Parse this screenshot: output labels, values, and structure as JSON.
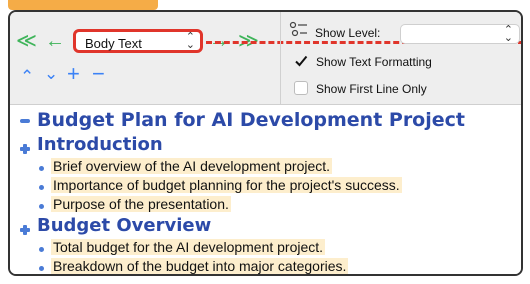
{
  "toolbar": {
    "style_select_value": "Body Text",
    "show_level_label": "Show Level:",
    "show_text_formatting_label": "Show Text Formatting",
    "show_first_line_only_label": "Show First Line Only",
    "show_text_formatting_checked": true,
    "show_first_line_only_checked": false
  },
  "document": {
    "title": "Budget Plan for AI Development Project",
    "sections": [
      {
        "heading": "Introduction",
        "items": [
          "Brief overview of the AI development project.",
          "Importance of budget planning for the project's success.",
          "Purpose of the presentation."
        ]
      },
      {
        "heading": "Budget Overview",
        "items": [
          "Total budget for the AI development project.",
          "Breakdown of the budget into major categories."
        ]
      }
    ]
  },
  "colors": {
    "accent_red": "#e0352b",
    "nav_green": "#3fb45a",
    "control_blue": "#3b82f6",
    "heading_blue": "#2c4aa8",
    "highlight": "#fdeecd",
    "tab_orange": "#f5ac47"
  }
}
